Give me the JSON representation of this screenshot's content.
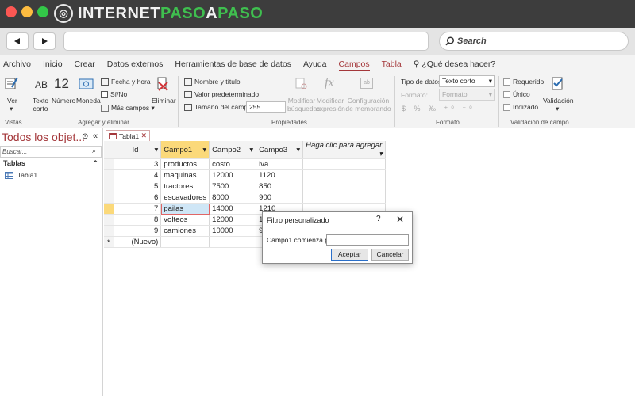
{
  "brand": {
    "part1": "INTERNET",
    "part2": "PASO",
    "part3": "A",
    "part4": "PASO"
  },
  "browser": {
    "search_label": "Search"
  },
  "ribbon_tabs": [
    {
      "label": "Archivo"
    },
    {
      "label": "Inicio"
    },
    {
      "label": "Crear"
    },
    {
      "label": "Datos externos"
    },
    {
      "label": "Herramientas de base de datos"
    },
    {
      "label": "Ayuda"
    },
    {
      "label": "Campos"
    },
    {
      "label": "Tabla"
    },
    {
      "label": "¿Qué desea hacer?"
    }
  ],
  "ribbon": {
    "ver": "Ver",
    "texto_corto": "Texto corto",
    "numero": "Número",
    "moneda": "Moneda",
    "fecha_hora": "Fecha y hora",
    "si_no": "Sí/No",
    "mas_campos": "Más campos",
    "eliminar": "Eliminar",
    "nombre_titulo": "Nombre y título",
    "valor_predeterminado": "Valor predeterminado",
    "tamano_campo": "Tamaño del campo",
    "tamano_value": "255",
    "modificar_busquedas": "Modificar búsquedas",
    "modificar_expresion": "Modificar expresión",
    "configuracion_memorando": "Configuración de memorando",
    "tipo_datos_label": "Tipo de datos:",
    "tipo_datos_value": "Texto corto",
    "formato_label": "Formato:",
    "formato_value": "Formato",
    "requerido": "Requerido",
    "unico": "Único",
    "indizado": "Indizado",
    "validacion": "Validación",
    "groups": {
      "vistas": "Vistas",
      "agregar_eliminar": "Agregar y eliminar",
      "propiedades": "Propiedades",
      "formato": "Formato",
      "validacion_campo": "Validación de campo"
    }
  },
  "nav_pane": {
    "title": "Todos los objet...",
    "search_placeholder": "Buscar...",
    "section": "Tablas",
    "items": [
      {
        "label": "Tabla1"
      }
    ]
  },
  "document": {
    "tab_label": "Tabla1",
    "columns": [
      {
        "label": "Id"
      },
      {
        "label": "Campo1"
      },
      {
        "label": "Campo2"
      },
      {
        "label": "Campo3"
      },
      {
        "label": "Haga clic para agregar"
      }
    ],
    "rows": [
      {
        "id": "3",
        "campo1": "productos",
        "campo2": "costo",
        "campo3": "iva"
      },
      {
        "id": "4",
        "campo1": "maquinas",
        "campo2": "12000",
        "campo3": "1120"
      },
      {
        "id": "5",
        "campo1": "tractores",
        "campo2": "7500",
        "campo3": "850"
      },
      {
        "id": "6",
        "campo1": "escavadores",
        "campo2": "8000",
        "campo3": "900"
      },
      {
        "id": "7",
        "campo1": "pailas",
        "campo2": "14000",
        "campo3": "1210"
      },
      {
        "id": "8",
        "campo1": "volteos",
        "campo2": "12000",
        "campo3": "1120"
      },
      {
        "id": "9",
        "campo1": "camiones",
        "campo2": "10000",
        "campo3": "950"
      }
    ],
    "new_row_label": "(Nuevo)",
    "new_row_marker": "*"
  },
  "dialog": {
    "title": "Filtro personalizado",
    "help": "?",
    "label": "Campo1 comienza por",
    "input_value": "",
    "ok_label": "Aceptar",
    "cancel_label": "Cancelar"
  },
  "colors": {
    "accent": "#a4373a",
    "selected_header": "#fbd97a",
    "brand_green": "#3fbf4f"
  }
}
